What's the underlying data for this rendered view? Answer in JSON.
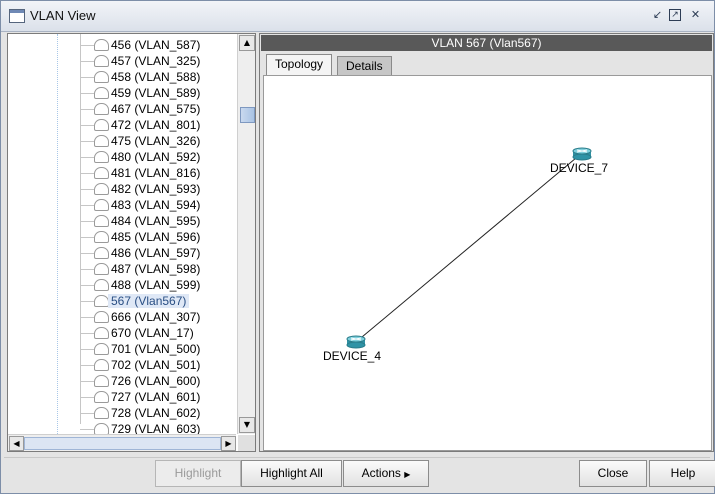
{
  "window": {
    "title": "VLAN View",
    "controls": [
      "minimize-icon",
      "maximize-icon",
      "close-icon"
    ]
  },
  "tree": {
    "items": [
      {
        "label": "456 (VLAN_587)"
      },
      {
        "label": "457 (VLAN_325)"
      },
      {
        "label": "458 (VLAN_588)"
      },
      {
        "label": "459 (VLAN_589)"
      },
      {
        "label": "467 (VLAN_575)"
      },
      {
        "label": "472 (VLAN_801)"
      },
      {
        "label": "475 (VLAN_326)"
      },
      {
        "label": "480 (VLAN_592)"
      },
      {
        "label": "481 (VLAN_816)"
      },
      {
        "label": "482 (VLAN_593)"
      },
      {
        "label": "483 (VLAN_594)"
      },
      {
        "label": "484 (VLAN_595)"
      },
      {
        "label": "485 (VLAN_596)"
      },
      {
        "label": "486 (VLAN_597)"
      },
      {
        "label": "487 (VLAN_598)"
      },
      {
        "label": "488 (VLAN_599)"
      },
      {
        "label": "567 (Vlan567)",
        "selected": true
      },
      {
        "label": "666 (VLAN_307)"
      },
      {
        "label": "670 (VLAN_17)"
      },
      {
        "label": "701 (VLAN_500)"
      },
      {
        "label": "702 (VLAN_501)"
      },
      {
        "label": "726 (VLAN_600)"
      },
      {
        "label": "727 (VLAN_601)"
      },
      {
        "label": "728 (VLAN_602)"
      },
      {
        "label": "729 (VLAN_603)"
      }
    ]
  },
  "detail": {
    "header": "VLAN 567 (Vlan567)",
    "tabs": [
      {
        "label": "Topology",
        "active": true
      },
      {
        "label": "Details",
        "active": false
      }
    ],
    "topology": {
      "devices": [
        {
          "name": "DEVICE_7"
        },
        {
          "name": "DEVICE_4"
        }
      ],
      "links": [
        [
          "DEVICE_4",
          "DEVICE_7"
        ]
      ]
    }
  },
  "footer": {
    "highlight": "Highlight",
    "highlight_all": "Highlight All",
    "actions": "Actions",
    "close": "Close",
    "help": "Help"
  }
}
